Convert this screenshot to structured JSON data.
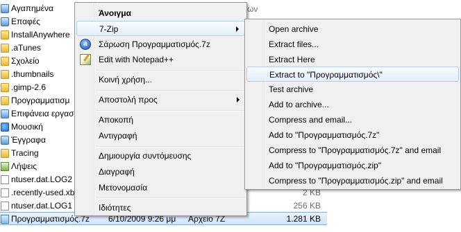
{
  "files": [
    {
      "name": "Αγαπημένα",
      "icon": "favorites-folder-icon",
      "date": "",
      "type": "",
      "size": ""
    },
    {
      "name": "Επαφές",
      "icon": "contacts-folder-icon",
      "date": "",
      "type": "",
      "size": ""
    },
    {
      "name": "InstallAnywhere",
      "icon": "folder-icon",
      "date": "",
      "type": "",
      "size": ""
    },
    {
      "name": ".aTunes",
      "icon": "folder-icon",
      "date": "",
      "type": "",
      "size": ""
    },
    {
      "name": "Σχολείο",
      "icon": "folder-icon",
      "date": "",
      "type": "",
      "size": ""
    },
    {
      "name": ".thumbnails",
      "icon": "folder-icon",
      "date": "",
      "type": "",
      "size": ""
    },
    {
      "name": ".gimp-2.6",
      "icon": "folder-icon",
      "date": "",
      "type": "",
      "size": ""
    },
    {
      "name": "Προγραμματισμ",
      "icon": "folder-icon",
      "date": "",
      "type": "",
      "size": ""
    },
    {
      "name": "Επιφάνεια εργασ",
      "icon": "desktop-folder-icon",
      "date": "",
      "type": "",
      "size": ""
    },
    {
      "name": "Μουσική",
      "icon": "music-folder-icon",
      "date": "",
      "type": "",
      "size": ""
    },
    {
      "name": "Έγγραφα",
      "icon": "documents-folder-icon",
      "date": "",
      "type": "",
      "size": ""
    },
    {
      "name": "Tracing",
      "icon": "folder-icon",
      "date": "",
      "type": "",
      "size": ""
    },
    {
      "name": "Λήψεις",
      "icon": "downloads-folder-icon",
      "date": "",
      "type": "",
      "size": ""
    },
    {
      "name": "ntuser.dat.LOG2",
      "icon": "file-icon",
      "date": "",
      "type": "",
      "size": ""
    },
    {
      "name": ".recently-used.xb",
      "icon": "file-icon",
      "date": "",
      "type": "",
      "size": "2 KB"
    },
    {
      "name": "ntuser.dat.LOG1",
      "icon": "file-icon",
      "date": "",
      "type": "",
      "size": "256 KB"
    },
    {
      "name": "Προγραμματισμός.7z",
      "icon": "archive-file-icon",
      "date": "6/10/2009 9:26 μμ",
      "type": "Αρχείο 7Z",
      "size": "1.281 KB"
    }
  ],
  "header_fragment": "ων",
  "context_menu": {
    "items": [
      {
        "label": "Άνοιγμα",
        "bold": true
      },
      {
        "label": "7-Zip",
        "submenu": true,
        "highlighted": true
      },
      {
        "label": "Σάρωση Προγραμματισμός.7z",
        "icon": "antivirus-scan-icon"
      },
      {
        "label": "Edit with Notepad++",
        "icon": "notepad-plus-plus-icon"
      },
      {
        "separator": true
      },
      {
        "label": "Κοινή χρήση..."
      },
      {
        "separator": true
      },
      {
        "label": "Αποστολή προς",
        "submenu": true
      },
      {
        "separator": true
      },
      {
        "label": "Αποκοπή"
      },
      {
        "label": "Αντιγραφή"
      },
      {
        "separator": true
      },
      {
        "label": "Δημιουργία συντόμευσης"
      },
      {
        "label": "Διαγραφή"
      },
      {
        "label": "Μετονομασία"
      },
      {
        "separator": true
      },
      {
        "label": "Ιδιότητες"
      }
    ]
  },
  "zip_submenu": {
    "items": [
      {
        "label": "Open archive"
      },
      {
        "label": "Extract files..."
      },
      {
        "label": "Extract Here"
      },
      {
        "label": "Extract to \"Προγραμματισμός\\\"",
        "highlighted": true
      },
      {
        "label": "Test archive"
      },
      {
        "label": "Add to archive..."
      },
      {
        "label": "Compress and email..."
      },
      {
        "label": "Add to \"Προγραμματισμός.7z\""
      },
      {
        "label": "Compress to \"Προγραμματισμός.7z\" and email"
      },
      {
        "label": "Add to \"Προγραμματισμός.zip\""
      },
      {
        "label": "Compress to \"Προγραμματισμός.zip\" and email"
      }
    ]
  },
  "colors": {
    "menu_background": "#f0f0f0",
    "highlight_border": "#aecff7",
    "selection_border": "#84acdd",
    "secondary_text": "#6d6d6d"
  }
}
